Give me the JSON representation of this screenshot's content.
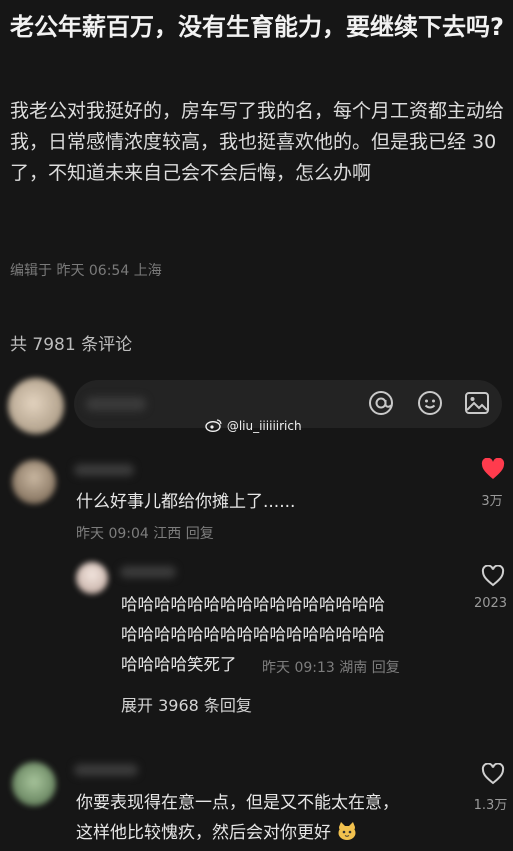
{
  "post": {
    "title": "老公年薪百万，没有生育能力，要继续下去吗?",
    "body": "我老公对我挺好的，房车写了我的名，每个月工资都主动给我，日常感情浓度较高，我也挺喜欢他的。但是我已经 30 了，不知道未来自己会不会后悔，怎么办啊",
    "edit_meta": "编辑于 昨天 06:54 上海"
  },
  "comments_header": {
    "count_label": "共 7981 条评论"
  },
  "input_bar": {
    "icons": [
      "at-icon",
      "emoji-icon",
      "image-icon"
    ]
  },
  "watermark": "@liu_iiiiiirich",
  "comments": [
    {
      "text": "什么好事儿都给你摊上了......",
      "meta": "昨天 09:04 江西 回复",
      "likes": "3万",
      "liked": true,
      "reply": {
        "text_lines": [
          "哈哈哈哈哈哈哈哈哈哈哈哈哈哈哈哈",
          "哈哈哈哈哈哈哈哈哈哈哈哈哈哈哈哈",
          "哈哈哈哈笑死了"
        ],
        "meta": "昨天 09:13 湖南 回复",
        "likes": "2023"
      },
      "expand": "展开 3968 条回复"
    },
    {
      "text_lines": [
        "你要表现得在意一点，但是又不能太在意，",
        "这样他比较愧疚，然后会对你更好"
      ],
      "likes": "1.3万"
    }
  ],
  "colors": {
    "background": "#161616",
    "heart_liked": "#ff3b4d"
  }
}
